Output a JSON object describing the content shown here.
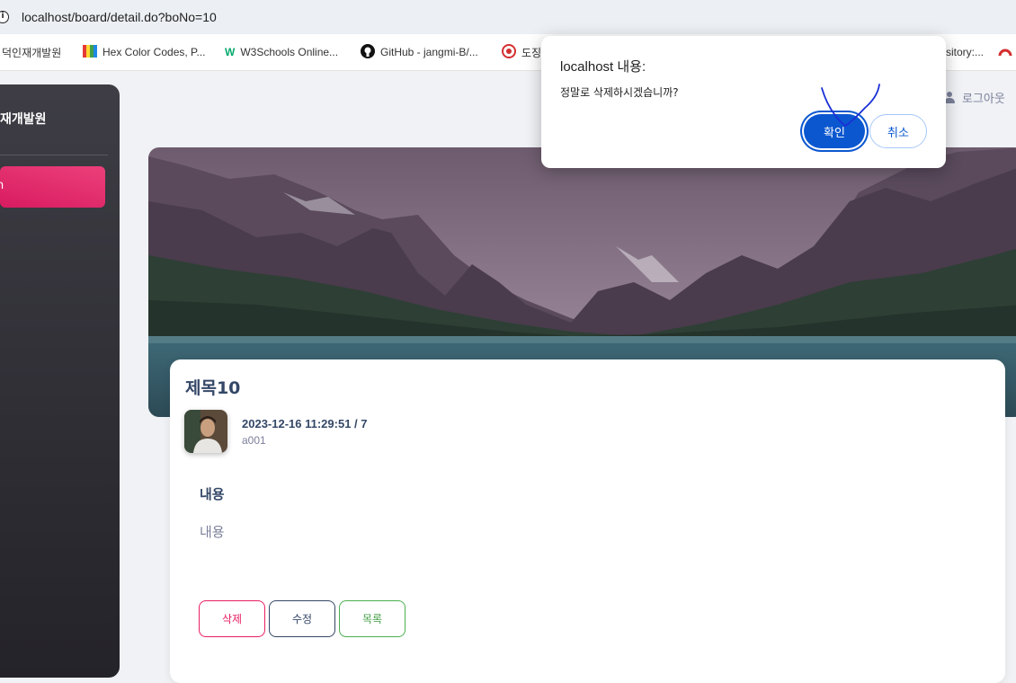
{
  "browser": {
    "url": "localhost/board/detail.do?boNo=10",
    "bookmarks": [
      {
        "label": "덕인재개발원",
        "icon": "folder-icon"
      },
      {
        "label": "Hex Color Codes, P...",
        "icon": "colorbook-icon"
      },
      {
        "label": "W3Schools Online...",
        "icon": "w3schools-icon"
      },
      {
        "label": "GitHub - jangmi-B/...",
        "icon": "github-icon"
      },
      {
        "label": "도징",
        "icon": "site-icon"
      },
      {
        "label": "sitory:...",
        "icon": "repo-icon"
      }
    ]
  },
  "sidebar": {
    "brand": "재개발원",
    "active_item": "h"
  },
  "header": {
    "logout_label": "로그아웃"
  },
  "post": {
    "title": "제목10",
    "meta": "2023-12-16 11:29:51 / 7",
    "writer": "a001",
    "content_label": "내용",
    "content_body": "내용"
  },
  "buttons": {
    "delete": "삭제",
    "edit": "수정",
    "list": "목록"
  },
  "dialog": {
    "title": "localhost 내용:",
    "message": "정말로 삭제하시겠습니까?",
    "confirm": "확인",
    "cancel": "취소"
  },
  "colors": {
    "accent_pink": "#e91e63",
    "dialog_blue": "#0b57d0",
    "heading": "#344767"
  }
}
